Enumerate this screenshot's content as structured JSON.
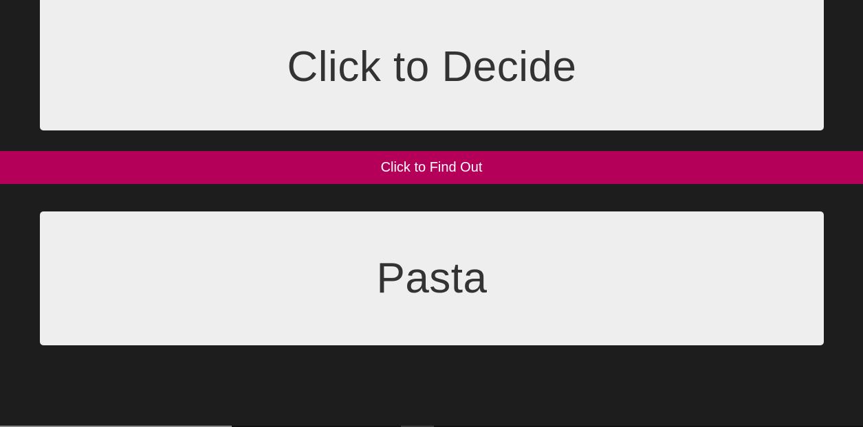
{
  "decide_card": {
    "label": "Click to Decide"
  },
  "find_out_bar": {
    "label": "Click to Find Out"
  },
  "result_card": {
    "label": "Pasta"
  },
  "colors": {
    "background": "#1d1d1d",
    "card": "#eeeeee",
    "card_text": "#333333",
    "accent": "#b5005a",
    "accent_text": "#ffffff"
  }
}
